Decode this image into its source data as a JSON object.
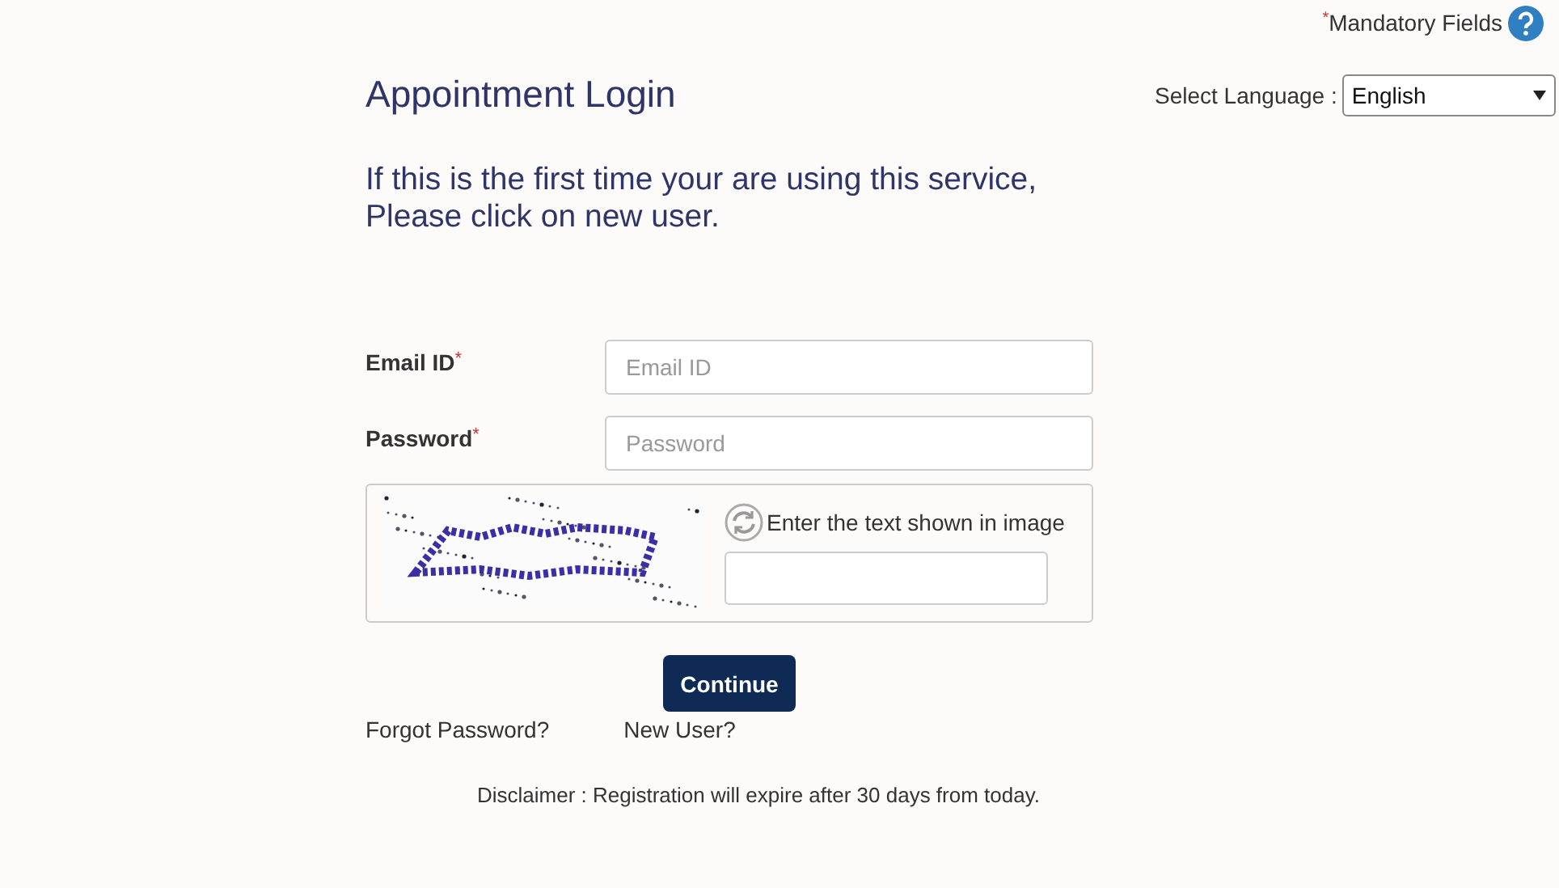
{
  "mandatory_note": {
    "marker": "*",
    "text": "Mandatory Fields"
  },
  "title": "Appointment Login",
  "language": {
    "label": "Select Language :",
    "value": "English"
  },
  "intro": "If this is the first time your are using this service, Please click on new user.",
  "fields": [
    {
      "label": "Email ID",
      "marker": "*",
      "placeholder": "Email ID"
    },
    {
      "label": "Password",
      "marker": "*",
      "placeholder": "Password"
    }
  ],
  "captcha": {
    "prompt": "Enter the text shown in image",
    "kind": "picture"
  },
  "continue_button": "Continue",
  "links": [
    "Forgot Password?",
    "New User?"
  ],
  "disclaimer": "Disclaimer : Registration will expire after 30 days from today."
}
